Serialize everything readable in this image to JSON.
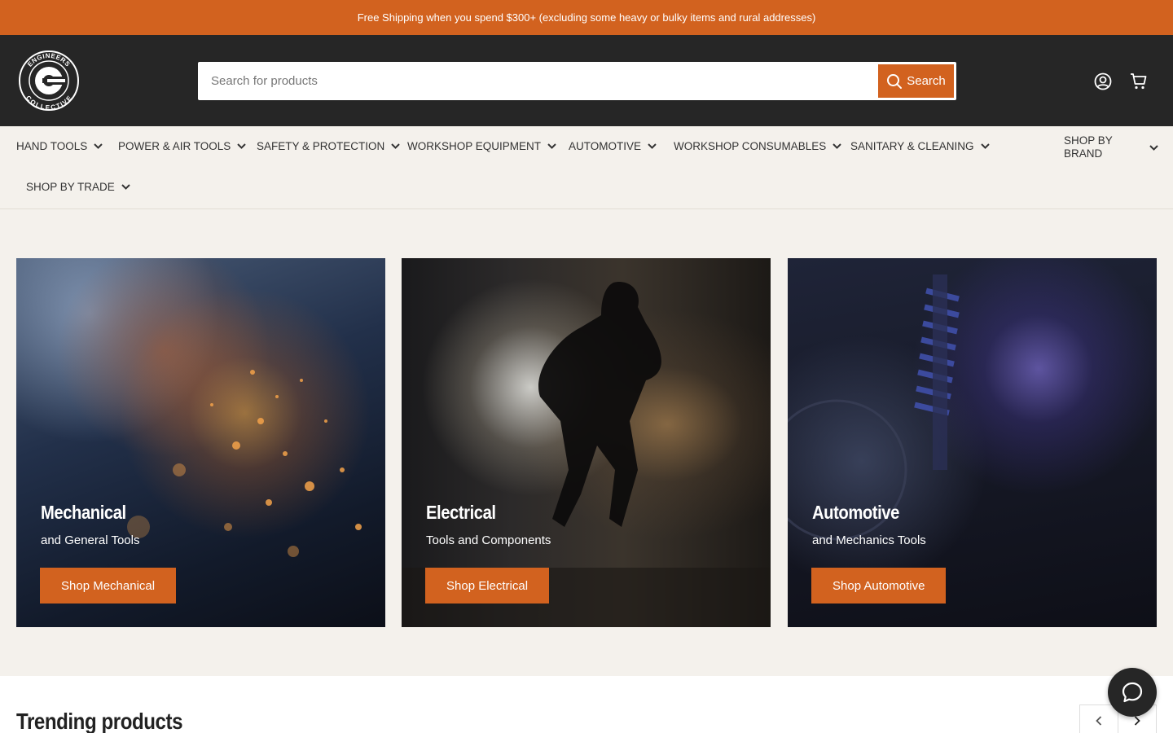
{
  "announcement": "Free Shipping when you spend $300+ (excluding some heavy or bulky items and rural addresses)",
  "brand": {
    "logo_top": "ENGINEERS",
    "logo_bottom": "COLLECTIVE"
  },
  "search": {
    "placeholder": "Search for products",
    "button_label": "Search"
  },
  "nav": {
    "items": [
      "HAND TOOLS",
      "POWER & AIR TOOLS",
      "SAFETY & PROTECTION",
      "WORKSHOP EQUIPMENT",
      "AUTOMOTIVE",
      "WORKSHOP CONSUMABLES",
      "SANITARY & CLEANING",
      "SHOP BY BRAND",
      "SHOP BY TRADE"
    ]
  },
  "tiles": [
    {
      "title": "Mechanical",
      "subtitle": "and General Tools",
      "button": "Shop Mechanical"
    },
    {
      "title": "Electrical",
      "subtitle": "Tools and Components",
      "button": "Shop Electrical"
    },
    {
      "title": "Automotive",
      "subtitle": "and Mechanics Tools",
      "button": "Shop Automotive"
    }
  ],
  "trending": {
    "title": "Trending products"
  },
  "colors": {
    "accent": "#d2621f",
    "header_bg": "#262626",
    "page_bg": "#f4f1ec"
  },
  "icons": [
    "search-icon",
    "account-icon",
    "cart-icon",
    "chevron-down-icon",
    "chevron-left-icon",
    "chevron-right-icon",
    "chat-icon"
  ]
}
